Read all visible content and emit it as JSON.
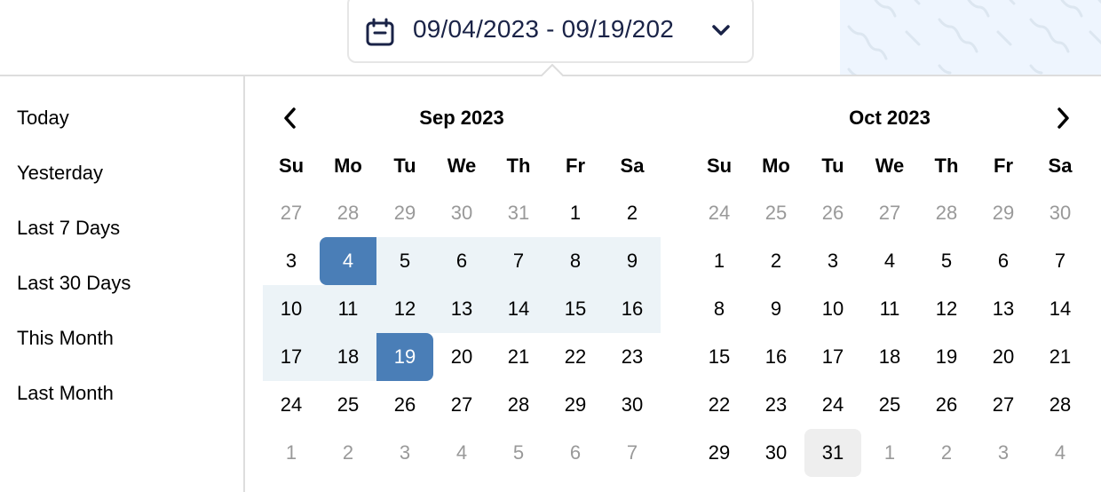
{
  "header": {
    "date_range_display": "09/04/2023 - 09/19/202",
    "calendar_icon": "calendar-icon",
    "dropdown_icon": "chevron-down-icon"
  },
  "colors": {
    "range_endpoint": "#4a7eb7",
    "range_fill": "#ecf3f7",
    "today_fill": "#eeeeee",
    "muted_text": "#999999",
    "button_text": "#1a2347",
    "pattern_bg": "#eef5fe"
  },
  "presets": [
    {
      "label": "Today"
    },
    {
      "label": "Yesterday"
    },
    {
      "label": "Last 7 Days"
    },
    {
      "label": "Last 30 Days"
    },
    {
      "label": "This Month"
    },
    {
      "label": "Last Month"
    }
  ],
  "weekdays": [
    "Su",
    "Mo",
    "Tu",
    "We",
    "Th",
    "Fr",
    "Sa"
  ],
  "calendars": [
    {
      "title": "Sep 2023",
      "nav": "prev",
      "nav_icon": "chevron-left-icon",
      "days": [
        {
          "d": "27",
          "muted": true
        },
        {
          "d": "28",
          "muted": true
        },
        {
          "d": "29",
          "muted": true
        },
        {
          "d": "30",
          "muted": true
        },
        {
          "d": "31",
          "muted": true
        },
        {
          "d": "1"
        },
        {
          "d": "2"
        },
        {
          "d": "3"
        },
        {
          "d": "4",
          "state": "range-start"
        },
        {
          "d": "5",
          "state": "in-range"
        },
        {
          "d": "6",
          "state": "in-range"
        },
        {
          "d": "7",
          "state": "in-range"
        },
        {
          "d": "8",
          "state": "in-range"
        },
        {
          "d": "9",
          "state": "in-range"
        },
        {
          "d": "10",
          "state": "in-range"
        },
        {
          "d": "11",
          "state": "in-range"
        },
        {
          "d": "12",
          "state": "in-range"
        },
        {
          "d": "13",
          "state": "in-range"
        },
        {
          "d": "14",
          "state": "in-range"
        },
        {
          "d": "15",
          "state": "in-range"
        },
        {
          "d": "16",
          "state": "in-range"
        },
        {
          "d": "17",
          "state": "in-range"
        },
        {
          "d": "18",
          "state": "in-range"
        },
        {
          "d": "19",
          "state": "range-end"
        },
        {
          "d": "20"
        },
        {
          "d": "21"
        },
        {
          "d": "22"
        },
        {
          "d": "23"
        },
        {
          "d": "24"
        },
        {
          "d": "25"
        },
        {
          "d": "26"
        },
        {
          "d": "27"
        },
        {
          "d": "28"
        },
        {
          "d": "29"
        },
        {
          "d": "30"
        },
        {
          "d": "1",
          "muted": true
        },
        {
          "d": "2",
          "muted": true
        },
        {
          "d": "3",
          "muted": true
        },
        {
          "d": "4",
          "muted": true
        },
        {
          "d": "5",
          "muted": true
        },
        {
          "d": "6",
          "muted": true
        },
        {
          "d": "7",
          "muted": true
        }
      ]
    },
    {
      "title": "Oct 2023",
      "nav": "next",
      "nav_icon": "chevron-right-icon",
      "days": [
        {
          "d": "24",
          "muted": true
        },
        {
          "d": "25",
          "muted": true
        },
        {
          "d": "26",
          "muted": true
        },
        {
          "d": "27",
          "muted": true
        },
        {
          "d": "28",
          "muted": true
        },
        {
          "d": "29",
          "muted": true
        },
        {
          "d": "30",
          "muted": true
        },
        {
          "d": "1"
        },
        {
          "d": "2"
        },
        {
          "d": "3"
        },
        {
          "d": "4"
        },
        {
          "d": "5"
        },
        {
          "d": "6"
        },
        {
          "d": "7"
        },
        {
          "d": "8"
        },
        {
          "d": "9"
        },
        {
          "d": "10"
        },
        {
          "d": "11"
        },
        {
          "d": "12"
        },
        {
          "d": "13"
        },
        {
          "d": "14"
        },
        {
          "d": "15"
        },
        {
          "d": "16"
        },
        {
          "d": "17"
        },
        {
          "d": "18"
        },
        {
          "d": "19"
        },
        {
          "d": "20"
        },
        {
          "d": "21"
        },
        {
          "d": "22"
        },
        {
          "d": "23"
        },
        {
          "d": "24"
        },
        {
          "d": "25"
        },
        {
          "d": "26"
        },
        {
          "d": "27"
        },
        {
          "d": "28"
        },
        {
          "d": "29"
        },
        {
          "d": "30"
        },
        {
          "d": "31",
          "state": "today"
        },
        {
          "d": "1",
          "muted": true
        },
        {
          "d": "2",
          "muted": true
        },
        {
          "d": "3",
          "muted": true
        },
        {
          "d": "4",
          "muted": true
        }
      ]
    }
  ]
}
